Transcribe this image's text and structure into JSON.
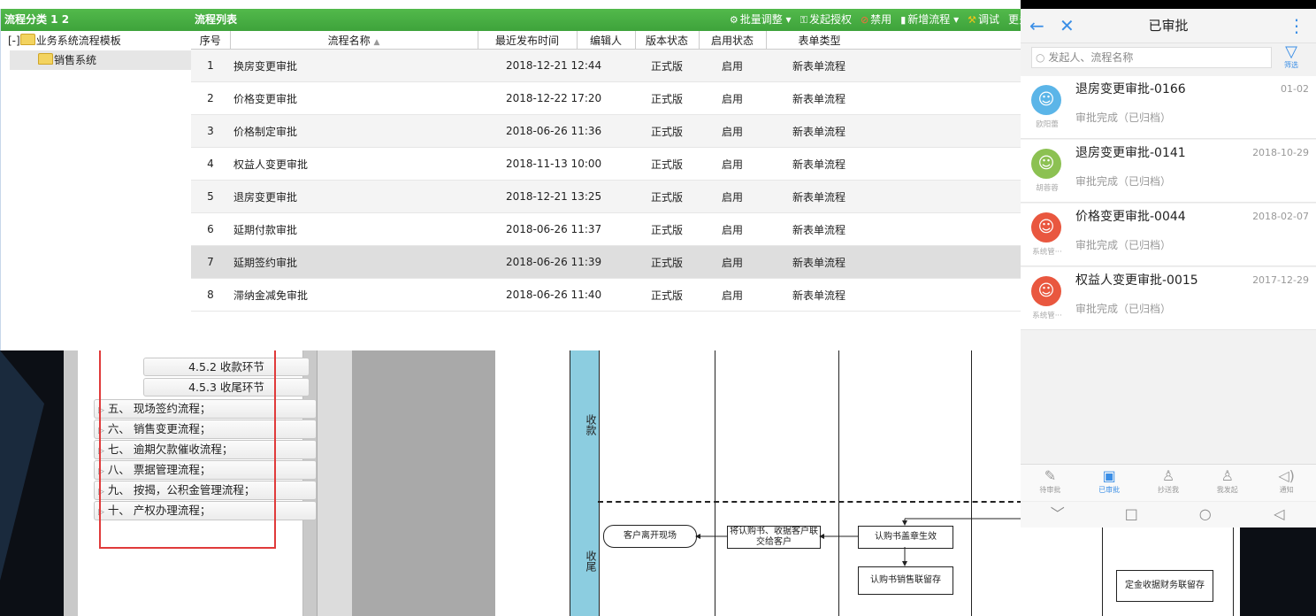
{
  "category_panel": {
    "title": "流程分类 1 2",
    "tree": {
      "toggle": "[-]",
      "root_label": "业务系统流程模板",
      "child_label": "销售系统"
    }
  },
  "list_panel": {
    "title": "流程列表",
    "toolbar": {
      "batch_adjust": "批量调整",
      "launch_auth": "发起授权",
      "disable": "禁用",
      "new_flow": "新增流程",
      "debug": "调试",
      "more": "更多"
    },
    "columns": {
      "index": "序号",
      "name": "流程名称",
      "publish_time": "最近发布时间",
      "editor": "编辑人",
      "version_status": "版本状态",
      "enable_status": "启用状态",
      "form_type": "表单类型"
    },
    "rows": [
      {
        "index": "1",
        "name": "换房变更审批",
        "publish_time": "2018-12-21 12:44",
        "editor": "",
        "version_status": "正式版",
        "enable_status": "启用",
        "form_type": "新表单流程"
      },
      {
        "index": "2",
        "name": "价格变更审批",
        "publish_time": "2018-12-22 17:20",
        "editor": "",
        "version_status": "正式版",
        "enable_status": "启用",
        "form_type": "新表单流程"
      },
      {
        "index": "3",
        "name": "价格制定审批",
        "publish_time": "2018-06-26 11:36",
        "editor": "",
        "version_status": "正式版",
        "enable_status": "启用",
        "form_type": "新表单流程"
      },
      {
        "index": "4",
        "name": "权益人变更审批",
        "publish_time": "2018-11-13 10:00",
        "editor": "",
        "version_status": "正式版",
        "enable_status": "启用",
        "form_type": "新表单流程"
      },
      {
        "index": "5",
        "name": "退房变更审批",
        "publish_time": "2018-12-21 13:25",
        "editor": "",
        "version_status": "正式版",
        "enable_status": "启用",
        "form_type": "新表单流程"
      },
      {
        "index": "6",
        "name": "延期付款审批",
        "publish_time": "2018-06-26 11:37",
        "editor": "",
        "version_status": "正式版",
        "enable_status": "启用",
        "form_type": "新表单流程"
      },
      {
        "index": "7",
        "name": "延期签约审批",
        "publish_time": "2018-06-26 11:39",
        "editor": "",
        "version_status": "正式版",
        "enable_status": "启用",
        "form_type": "新表单流程"
      },
      {
        "index": "8",
        "name": "滞纳金减免审批",
        "publish_time": "2018-06-26 11:40",
        "editor": "",
        "version_status": "正式版",
        "enable_status": "启用",
        "form_type": "新表单流程"
      }
    ]
  },
  "outline": {
    "sub_items": [
      "4.5.2 收款环节",
      "4.5.3 收尾环节"
    ],
    "items": [
      "五、 现场签约流程；",
      "六、 销售变更流程；",
      "七、 逾期欠款催收流程；",
      "八、 票据管理流程；",
      "九、 按揭，公积金管理流程；",
      "十、 产权办理流程；"
    ]
  },
  "flowchart": {
    "lane_1": "收款",
    "lane_2": "收尾",
    "box_leave": "客户离开现场",
    "box_deliver": "将认购书、收据客户联交给客户",
    "box_effect": "认购书盖章生效",
    "box_archive": "认购书销售联留存",
    "box_finance": "定金收据财务联留存"
  },
  "mobile": {
    "title": "已审批",
    "search_placeholder": "发起人、流程名称",
    "filter_label": "筛选",
    "items": [
      {
        "name": "退房变更审批-0166",
        "date": "01-02",
        "status": "审批完成（已归档）",
        "who": "欧阳蕾",
        "color": "#5bb5e8"
      },
      {
        "name": "退房变更审批-0141",
        "date": "2018-10-29",
        "status": "审批完成（已归档）",
        "who": "胡蓉蓉",
        "color": "#8cc152"
      },
      {
        "name": "价格变更审批-0044",
        "date": "2018-02-07",
        "status": "审批完成（已归档）",
        "who": "系统管···",
        "color": "#e9573f"
      },
      {
        "name": "权益人变更审批-0015",
        "date": "2017-12-29",
        "status": "审批完成（已归档）",
        "who": "系统管···",
        "color": "#e9573f"
      }
    ],
    "tabs": [
      "待审批",
      "已审批",
      "抄送我",
      "我发起",
      "通知"
    ]
  },
  "colors": {
    "header_green": "#3ea33b",
    "mobile_accent": "#3a8ee6",
    "outline_red": "#e03a3a",
    "lane_blue": "#8ccde0"
  }
}
